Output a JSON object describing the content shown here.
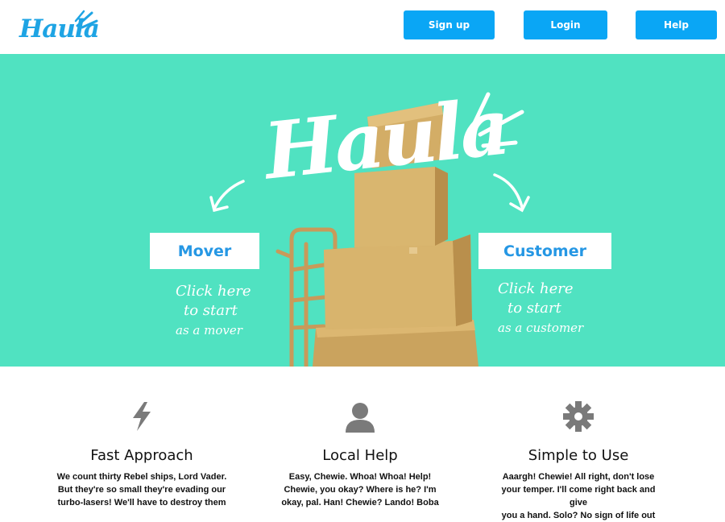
{
  "header": {
    "logo_text": "Haula",
    "nav": {
      "signup_label": "Sign up",
      "login_label": "Login",
      "help_label": "Help"
    }
  },
  "hero": {
    "title": "Haula",
    "mover": {
      "button_label": "Mover",
      "note_lines": [
        "Click here",
        "to start",
        "as a mover"
      ]
    },
    "customer": {
      "button_label": "Customer",
      "note_lines": [
        "Click here",
        "to start",
        "as a customer"
      ]
    }
  },
  "features": [
    {
      "icon": "lightning-icon",
      "title": "Fast Approach",
      "text_lines": [
        "We count thirty Rebel ships, Lord Vader.",
        "But they're so small they're evading our",
        "turbo-lasers! We'll have to destroy them"
      ]
    },
    {
      "icon": "person-icon",
      "title": "Local Help",
      "text_lines": [
        "Easy, Chewie. Whoa! Whoa! Help!",
        "Chewie, you okay? Where is he? I'm",
        "okay, pal. Han! Chewie? Lando! Boba"
      ]
    },
    {
      "icon": "gear-icon",
      "title": "Simple to Use",
      "text_lines": [
        "Aaargh! Chewie! All right, don't lose",
        "your temper. I'll come right back and give",
        "you a hand. Solo? No sign of life out"
      ]
    }
  ],
  "colors": {
    "brand_blue": "#0aa6f5",
    "hero_teal": "#50e2c1",
    "cta_text": "#2597e4",
    "icon_gray": "#7a7a7a"
  }
}
